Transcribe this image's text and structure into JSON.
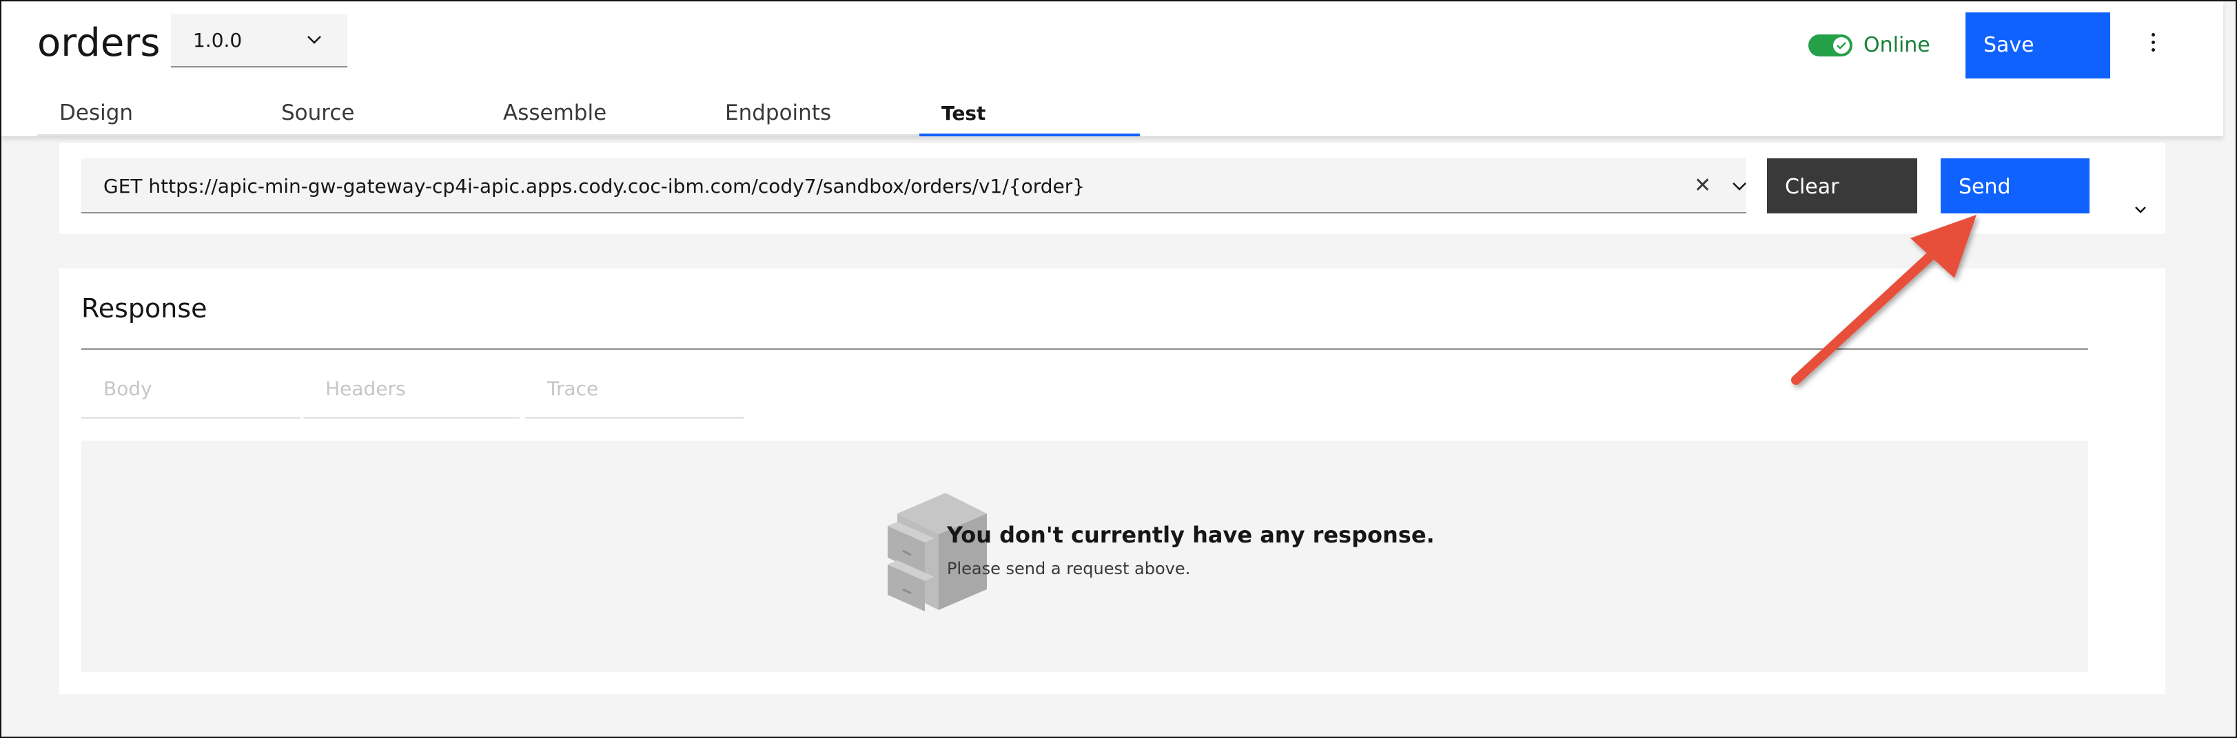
{
  "header": {
    "api_title": "orders",
    "version": "1.0.0",
    "status_label": "Online",
    "save_label": "Save",
    "tabs": [
      {
        "label": "Design"
      },
      {
        "label": "Source"
      },
      {
        "label": "Assemble"
      },
      {
        "label": "Endpoints"
      },
      {
        "label": "Test",
        "active": true
      }
    ]
  },
  "request": {
    "url": "GET https://apic-min-gw-gateway-cp4i-apic.apps.cody.coc-ibm.com/cody7/sandbox/orders/v1/{order}",
    "clear_label": "Clear",
    "send_label": "Send"
  },
  "response": {
    "title": "Response",
    "tabs": [
      {
        "label": "Body"
      },
      {
        "label": "Headers"
      },
      {
        "label": "Trace"
      }
    ],
    "empty_title": "You don't currently have any response.",
    "empty_subtitle": "Please send a request above."
  },
  "colors": {
    "primary": "#0f62fe",
    "online": "#24a148",
    "annotation_arrow": "#e8503a"
  },
  "icons": [
    "chevron-down-icon",
    "checkmark-icon",
    "overflow-menu-icon",
    "close-icon",
    "file-cabinet-icon"
  ]
}
